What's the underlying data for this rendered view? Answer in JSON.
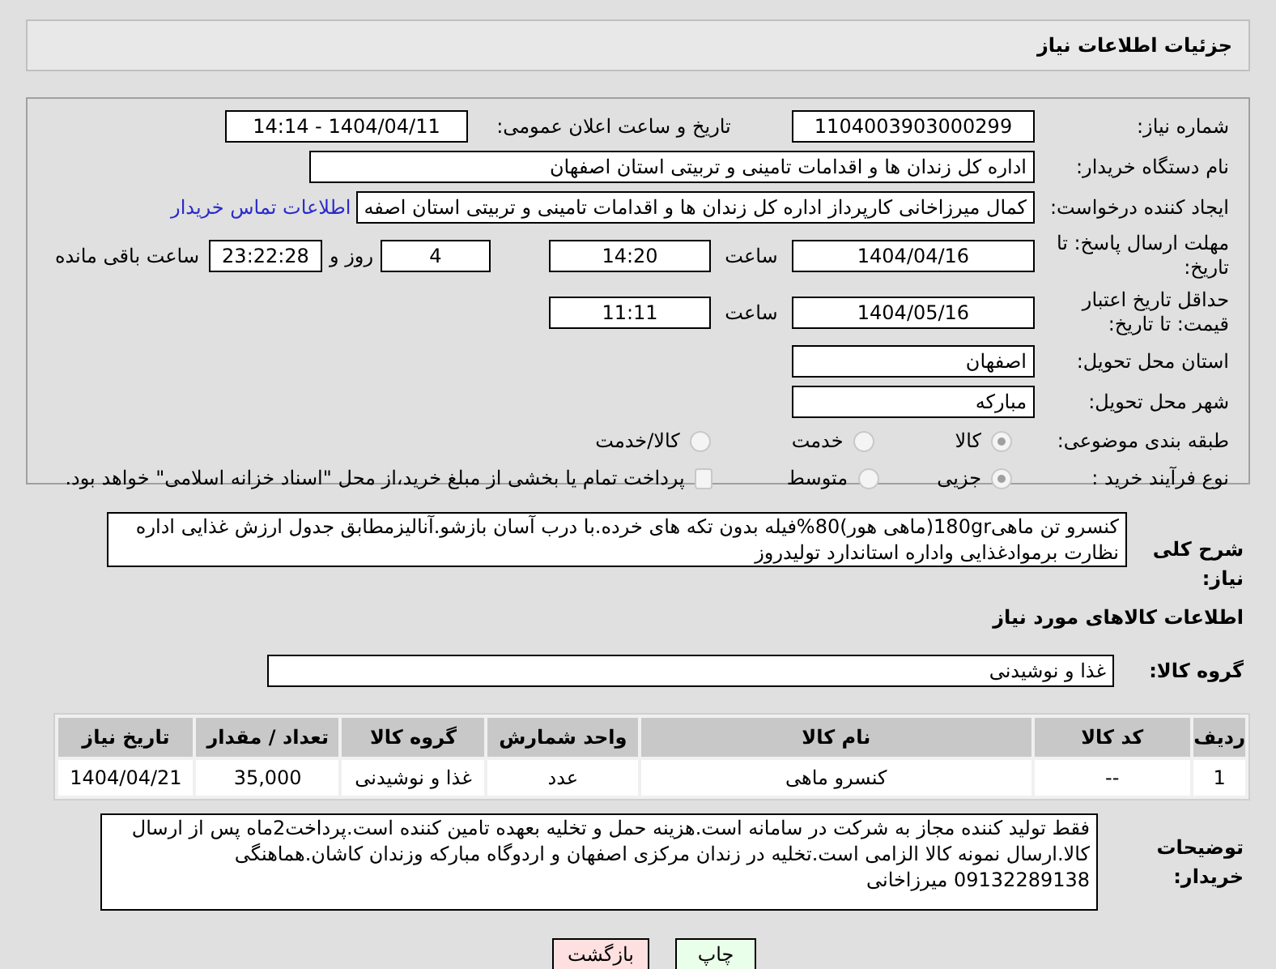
{
  "header": {
    "title": "جزئیات اطلاعات نیاز"
  },
  "need_number": {
    "label": "شماره نیاز:",
    "value": "1104003903000299"
  },
  "announce": {
    "label": "تاریخ و ساعت اعلان عمومی:",
    "value": "1404/04/11 - 14:14"
  },
  "buyer": {
    "label": "نام دستگاه خریدار:",
    "value": "اداره کل زندان ها و اقدامات تامینی و تربیتی استان اصفهان"
  },
  "requester": {
    "label": "ایجاد کننده درخواست:",
    "value": "کمال میرزاخانی کارپرداز اداره کل زندان ها و اقدامات تامینی و تربیتی استان اصفه",
    "link": "اطلاعات تماس خریدار"
  },
  "deadline": {
    "label": "مهلت ارسال پاسخ: تا تاریخ:",
    "date": "1404/04/16",
    "time_label": "ساعت",
    "time": "14:20",
    "days": "4",
    "days_label": "روز و",
    "remaining": "23:22:28",
    "remaining_label": "ساعت باقی مانده"
  },
  "validity": {
    "label": "حداقل تاریخ اعتبار قیمت: تا تاریخ:",
    "date": "1404/05/16",
    "time_label": "ساعت",
    "time": "11:11"
  },
  "province": {
    "label": "استان محل تحویل:",
    "value": "اصفهان"
  },
  "city": {
    "label": "شهر محل تحویل:",
    "value": "مبارکه"
  },
  "category": {
    "label": "طبقه بندی موضوعی:",
    "options": [
      {
        "label": "کالا",
        "selected": true
      },
      {
        "label": "خدمت",
        "selected": false
      },
      {
        "label": "کالا/خدمت",
        "selected": false
      }
    ]
  },
  "process": {
    "label": "نوع فرآیند خرید :",
    "options": [
      {
        "label": "جزیی",
        "selected": true
      },
      {
        "label": "متوسط",
        "selected": false
      }
    ],
    "payment": {
      "label": "پرداخت تمام یا بخشی از مبلغ خرید،از محل \"اسناد خزانه اسلامی\" خواهد بود.",
      "checked": false
    }
  },
  "description": {
    "label": "شرح کلی نیاز:",
    "value": "کنسرو تن ماهی180gr(ماهی هور)80%فیله بدون تکه های خرده.با درب آسان بازشو.آنالیزمطابق جدول ارزش غذایی اداره نظارت برموادغذایی واداره استاندارد تولیدروز"
  },
  "goods_title": "اطلاعات کالاهای مورد نیاز",
  "goods_group": {
    "label": "گروه کالا:",
    "value": "غذا و نوشیدنی"
  },
  "table": {
    "columns": [
      "ردیف",
      "کد کالا",
      "نام کالا",
      "واحد شمارش",
      "گروه کالا",
      "تعداد / مقدار",
      "تاریخ نیاز"
    ],
    "rows": [
      [
        "1",
        "--",
        "کنسرو ماهی",
        "عدد",
        "غذا و نوشیدنی",
        "35,000",
        "1404/04/21"
      ]
    ]
  },
  "buyer_notes": {
    "label": "توضیحات خریدار:",
    "value": "فقط تولید کننده مجاز به شرکت در سامانه است.هزینه حمل و تخلیه بعهده تامین کننده است.پرداخت2ماه پس از ارسال کالا.ارسال نمونه کالا الزامی است.تخلیه در زندان مرکزی اصفهان و اردوگاه مبارکه وزندان کاشان.هماهنگی  09132289138 میرزاخانی"
  },
  "buttons": [
    {
      "label": "چاپ",
      "kind": "print"
    },
    {
      "label": "بازگشت",
      "kind": "back"
    }
  ]
}
